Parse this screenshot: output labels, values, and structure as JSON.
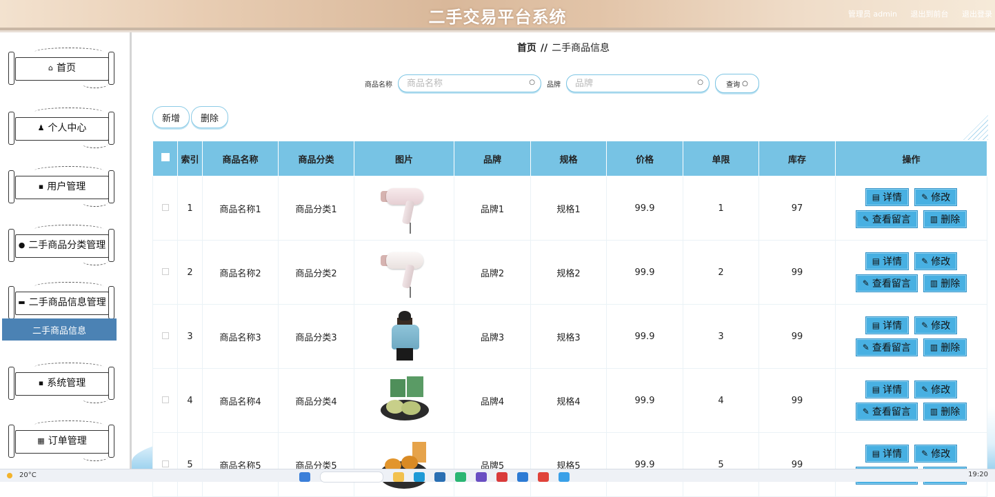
{
  "header": {
    "title": "二手交易平台系统",
    "user_label": "管理员 admin",
    "to_front": "退出到前台",
    "logout": "退出登录"
  },
  "sidebar": {
    "items": [
      {
        "label": "首页",
        "icon": "home-icon",
        "glyph": "⌂"
      },
      {
        "label": "个人中心",
        "icon": "person-icon",
        "glyph": "♟"
      },
      {
        "label": "用户管理",
        "icon": "grid-icon",
        "glyph": "▪"
      },
      {
        "label": "二手商品分类管理",
        "icon": "pin-icon",
        "glyph": "●"
      },
      {
        "label": "二手商品信息管理",
        "icon": "briefcase-icon",
        "glyph": "▬"
      },
      {
        "label": "系统管理",
        "icon": "grid-icon",
        "glyph": "▪"
      },
      {
        "label": "订单管理",
        "icon": "table-icon",
        "glyph": "▦"
      }
    ],
    "submenu": "二手商品信息"
  },
  "breadcrumb": {
    "home": "首页",
    "sep": "//",
    "current": "二手商品信息"
  },
  "search": {
    "name_label": "商品名称",
    "name_placeholder": "商品名称",
    "brand_label": "品牌",
    "brand_placeholder": "品牌",
    "query_label": "查询"
  },
  "actions": {
    "add": "新增",
    "delete": "删除"
  },
  "table": {
    "columns": [
      "索引",
      "商品名称",
      "商品分类",
      "图片",
      "品牌",
      "规格",
      "价格",
      "单限",
      "库存",
      "操作"
    ],
    "rows": [
      {
        "index": "1",
        "name": "商品名称1",
        "category": "商品分类1",
        "image": "hair-dryer-pink",
        "brand": "品牌1",
        "spec": "规格1",
        "price": "99.9",
        "limit": "1",
        "stock": "97"
      },
      {
        "index": "2",
        "name": "商品名称2",
        "category": "商品分类2",
        "image": "hair-dryer-white",
        "brand": "品牌2",
        "spec": "规格2",
        "price": "99.9",
        "limit": "2",
        "stock": "99"
      },
      {
        "index": "3",
        "name": "商品名称3",
        "category": "商品分类3",
        "image": "person-in-hoodie",
        "brand": "品牌3",
        "spec": "规格3",
        "price": "99.9",
        "limit": "3",
        "stock": "99"
      },
      {
        "index": "4",
        "name": "商品名称4",
        "category": "商品分类4",
        "image": "mooncakes",
        "brand": "品牌4",
        "spec": "规格4",
        "price": "99.9",
        "limit": "4",
        "stock": "99"
      },
      {
        "index": "5",
        "name": "商品名称5",
        "category": "商品分类5",
        "image": "biscuits",
        "brand": "品牌5",
        "spec": "规格5",
        "price": "99.9",
        "limit": "5",
        "stock": "99"
      }
    ],
    "ops": {
      "detail": "详情",
      "edit": "修改",
      "comments": "查看留言",
      "remove": "删除"
    }
  },
  "taskbar": {
    "temperature": "20°C",
    "time": "19:20"
  },
  "colors": {
    "table_header": "#77c3e4",
    "op_button": "#48b0e2",
    "submenu_active": "#4b82b4"
  }
}
